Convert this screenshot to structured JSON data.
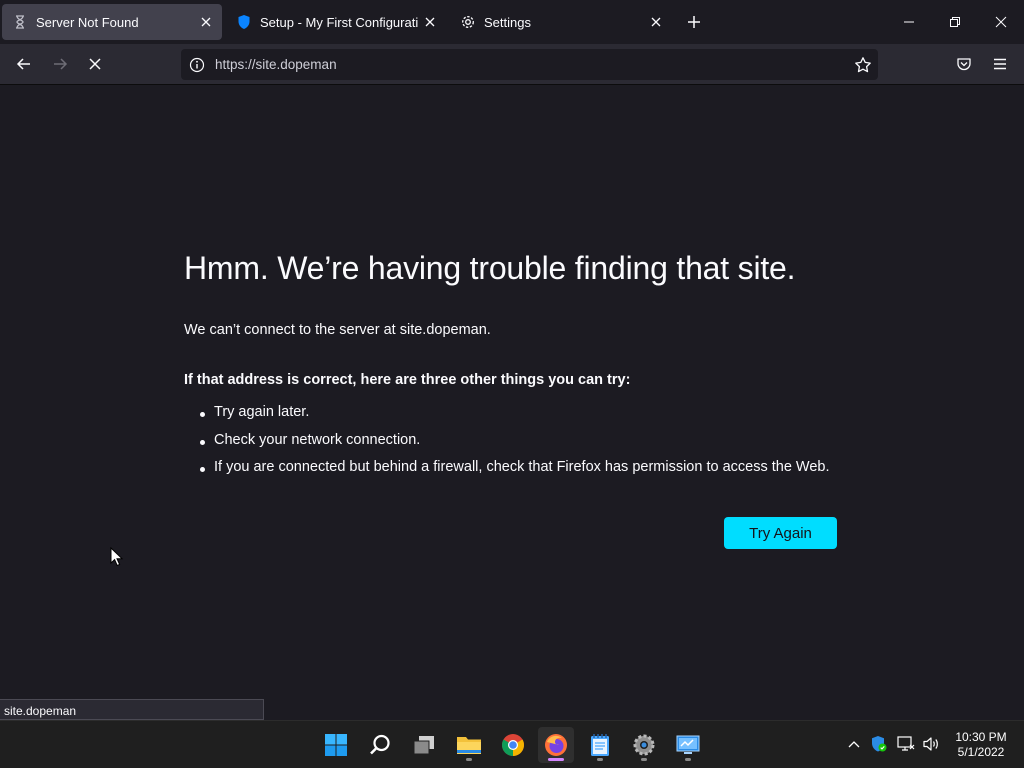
{
  "tabs": [
    {
      "label": "Server Not Found",
      "icon": "hourglass-icon",
      "active": true
    },
    {
      "label": "Setup - My First Configuration",
      "icon": "shield-icon",
      "active": false
    },
    {
      "label": "Settings",
      "icon": "gear-icon",
      "active": false
    }
  ],
  "address_bar": {
    "url": "https://site.dopeman"
  },
  "error_page": {
    "title": "Hmm. We’re having trouble finding that site.",
    "description": "We can’t connect to the server at site.dopeman.",
    "suggestions_heading": "If that address is correct, here are three other things you can try:",
    "suggestions": [
      "Try again later.",
      "Check your network connection.",
      "If you are connected but behind a firewall, check that Firefox has permission to access the Web."
    ],
    "try_again_label": "Try Again"
  },
  "status_bar": {
    "text": "site.dopeman"
  },
  "taskbar": {
    "apps": [
      "start-icon",
      "search-icon",
      "task-view-icon",
      "file-explorer-icon",
      "chrome-icon",
      "firefox-icon",
      "notepad-icon",
      "settings-icon",
      "control-panel-icon"
    ],
    "clock": {
      "time": "10:30 PM",
      "date": "5/1/2022"
    }
  },
  "colors": {
    "accent": "#00ddff",
    "background": "#1c1b22",
    "toolbar": "#2b2a33",
    "active_tab": "#42414d"
  }
}
